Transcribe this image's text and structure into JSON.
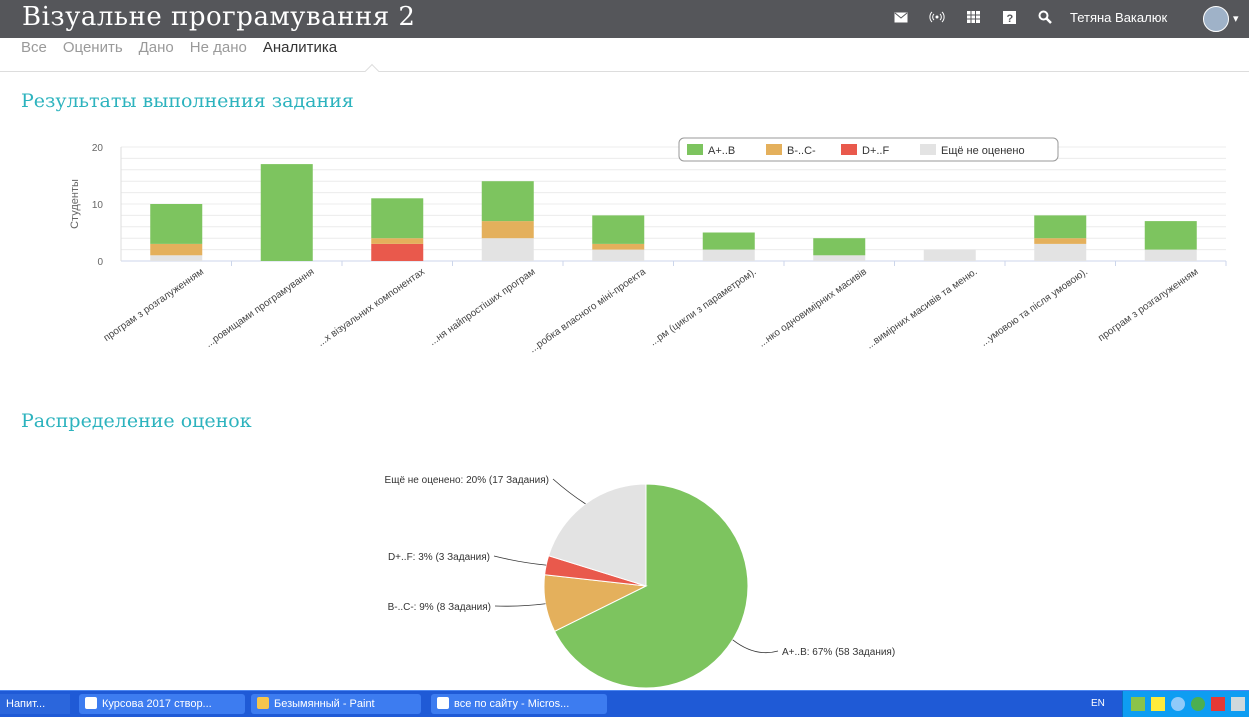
{
  "header": {
    "title": "Візуальне програмування 2",
    "user": "Тетяна Вакалюк",
    "icons": [
      "mail-icon",
      "signal-icon",
      "calendar-icon",
      "help-icon",
      "search-icon"
    ]
  },
  "tabs": [
    {
      "label": "Все"
    },
    {
      "label": "Оценить"
    },
    {
      "label": "Дано"
    },
    {
      "label": "Не дано"
    },
    {
      "label": "Аналитика",
      "active": true
    }
  ],
  "results": {
    "title": "Результаты выполнения задания",
    "ylabel": "Студенты"
  },
  "distribution": {
    "title": "Распределение оценок"
  },
  "colors": {
    "ab": "#7dc45f",
    "bc": "#e4b05c",
    "df": "#e9594c",
    "none": "#e3e3e3",
    "accent": "#2db3be",
    "header": "#55565a"
  },
  "chart_data": [
    {
      "type": "bar",
      "stacked": true,
      "ylabel": "Студенты",
      "ylim": [
        0,
        20
      ],
      "yticks": [
        0,
        10,
        20
      ],
      "legend_position": "top-right",
      "categories": [
        "програм з розгалуженням",
        "...ровищами програмування",
        "...х візуальних компонентах",
        "...ня найпростіших програм",
        "...робка власного міні-проекта",
        "...рм (цикли з параметром).",
        "...нко одновимірних масивів",
        "...вимірних масивів та меню.",
        "...умовою та після умовою).",
        "програм з розгалуженням"
      ],
      "series": [
        {
          "name": "Ещё не оценено",
          "color": "#e3e3e3",
          "values": [
            1,
            0,
            0,
            4,
            2,
            2,
            1,
            2,
            3,
            2
          ]
        },
        {
          "name": "D+..F",
          "color": "#e9594c",
          "values": [
            0,
            0,
            3,
            0,
            0,
            0,
            0,
            0,
            0,
            0
          ]
        },
        {
          "name": "B-..C-",
          "color": "#e4b05c",
          "values": [
            2,
            0,
            1,
            3,
            1,
            0,
            0,
            0,
            1,
            0
          ]
        },
        {
          "name": "A+..B",
          "color": "#7dc45f",
          "values": [
            7,
            17,
            7,
            7,
            5,
            3,
            3,
            0,
            4,
            5
          ]
        }
      ],
      "legend": [
        "A+..B",
        "B-..C-",
        "D+..F",
        "Ещё не оценено"
      ]
    },
    {
      "type": "pie",
      "slices": [
        {
          "name": "A+..B",
          "value": 67,
          "label": "A+..B: 67% (58 Задания)",
          "color": "#7dc45f"
        },
        {
          "name": "B-..C-",
          "value": 9,
          "label": "B-..C-: 9% (8 Задания)",
          "color": "#e4b05c"
        },
        {
          "name": "D+..F",
          "value": 3,
          "label": "D+..F: 3% (3 Задания)",
          "color": "#e9594c"
        },
        {
          "name": "Ещё не оценено",
          "value": 20,
          "label": "Ещё не оценено: 20% (17 Задания)",
          "color": "#e3e3e3"
        }
      ]
    }
  ],
  "taskbar": {
    "start_label": "Напит...",
    "tasks": [
      {
        "label": "Курсова 2017 створ..."
      },
      {
        "label": "Безымянный - Paint"
      },
      {
        "label": "все по сайту - Micros..."
      }
    ],
    "lang": "EN"
  }
}
